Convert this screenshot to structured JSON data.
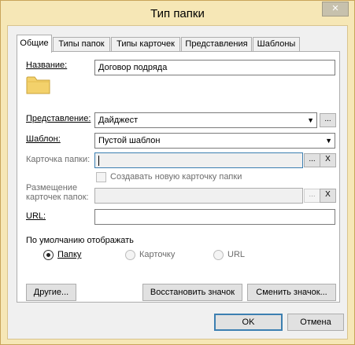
{
  "window": {
    "title": "Тип папки",
    "close_glyph": "×"
  },
  "tabs": [
    {
      "label": "Общие",
      "active": true
    },
    {
      "label": "Типы папок",
      "active": false
    },
    {
      "label": "Типы карточек",
      "active": false
    },
    {
      "label": "Представления",
      "active": false
    },
    {
      "label": "Шаблоны",
      "active": false
    }
  ],
  "general": {
    "name_label": "Название:",
    "name_value": "Договор подряда",
    "folder_icon_name": "folder-icon",
    "view_label": "Представление:",
    "view_value": "Дайджест",
    "template_label": "Шаблон:",
    "template_value": "Пустой шаблон",
    "card_folder_label": "Карточка папки:",
    "card_folder_value": "",
    "create_card_checkbox_label": "Создавать новую карточку папки",
    "create_card_checked": false,
    "placement_label_line1": "Размещение",
    "placement_label_line2": "карточек папок:",
    "placement_value": "",
    "url_label": "URL:",
    "url_value": "",
    "default_display_label": "По умолчанию отображать",
    "display_options": [
      {
        "label": "Папку",
        "selected": true,
        "enabled": true
      },
      {
        "label": "Карточку",
        "selected": false,
        "enabled": false
      },
      {
        "label": "URL",
        "selected": false,
        "enabled": false
      }
    ],
    "browse_glyph": "...",
    "clear_glyph": "X",
    "dropdown_glyph": "▼",
    "other_button": "Другие...",
    "restore_icon_button": "Восстановить значок",
    "change_icon_button": "Сменить значок..."
  },
  "footer": {
    "ok_button": "OK",
    "cancel_button": "Отмена"
  },
  "colors": {
    "window_frame": "#f6e7b6",
    "client_bg": "#f0f0f0",
    "folder_yellow": "#f3d16b",
    "focus_blue": "#3c7fb1"
  }
}
